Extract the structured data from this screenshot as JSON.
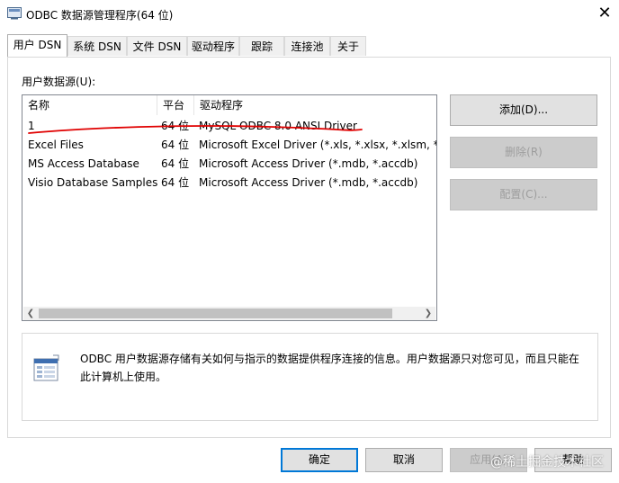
{
  "window": {
    "title": "ODBC 数据源管理程序(64 位)"
  },
  "tabs": [
    {
      "label": "用户 DSN"
    },
    {
      "label": "系统 DSN"
    },
    {
      "label": "文件 DSN"
    },
    {
      "label": "驱动程序"
    },
    {
      "label": "跟踪"
    },
    {
      "label": "连接池"
    },
    {
      "label": "关于"
    }
  ],
  "datasources": {
    "label": "用户数据源(U):",
    "columns": [
      "名称",
      "平台",
      "驱动程序"
    ],
    "rows": [
      {
        "name": "1",
        "platform": "64 位",
        "driver": "MySQL ODBC 8.0 ANSI Driver"
      },
      {
        "name": "Excel Files",
        "platform": "64 位",
        "driver": "Microsoft Excel Driver (*.xls, *.xlsx, *.xlsm, *.xlsb)"
      },
      {
        "name": "MS Access Database",
        "platform": "64 位",
        "driver": "Microsoft Access Driver (*.mdb, *.accdb)"
      },
      {
        "name": "Visio Database Samples",
        "platform": "64 位",
        "driver": "Microsoft Access Driver (*.mdb, *.accdb)"
      }
    ]
  },
  "side_buttons": {
    "add": "添加(D)...",
    "remove": "删除(R)",
    "configure": "配置(C)..."
  },
  "info": {
    "text": "ODBC 用户数据源存储有关如何与指示的数据提供程序连接的信息。用户数据源只对您可见，而且只能在此计算机上使用。"
  },
  "footer": {
    "ok": "确定",
    "cancel": "取消",
    "apply": "应用(A)",
    "help": "帮助"
  },
  "watermark": "@稀土掘金技术社区",
  "colors": {
    "annotation": "#e00000",
    "focus": "#0078d7"
  }
}
